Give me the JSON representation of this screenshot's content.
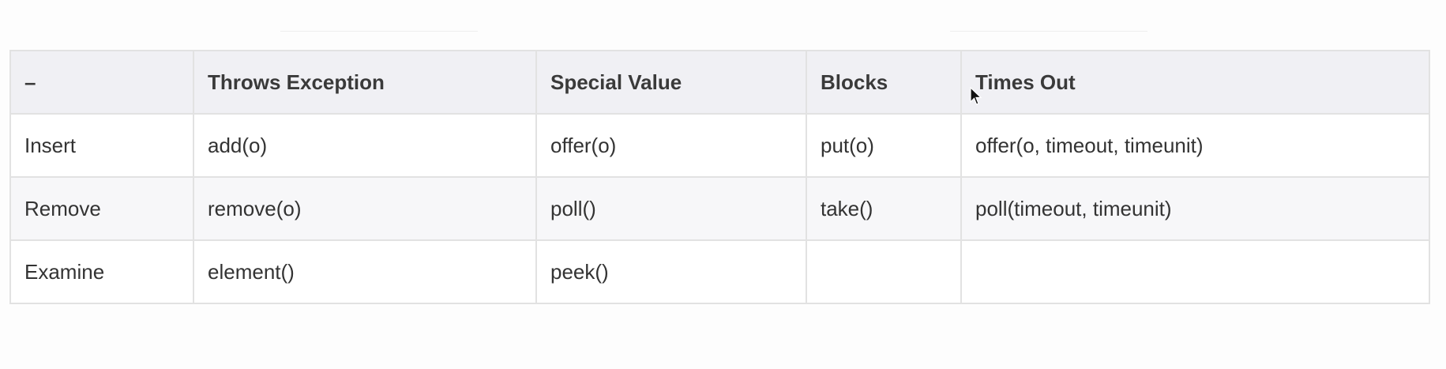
{
  "table": {
    "headers": [
      "–",
      "Throws Exception",
      "Special Value",
      "Blocks",
      "Times Out"
    ],
    "rows": [
      [
        "Insert",
        "add(o)",
        "offer(o)",
        "put(o)",
        "offer(o, timeout, timeunit)"
      ],
      [
        "Remove",
        "remove(o)",
        "poll()",
        "take()",
        "poll(timeout, timeunit)"
      ],
      [
        "Examine",
        "element()",
        "peek()",
        "",
        ""
      ]
    ]
  },
  "colors": {
    "header_background": "#f0f0f4",
    "border": "#e2e2e2",
    "text": "#333333"
  },
  "icons": {
    "cursor": "mouse-pointer-icon"
  }
}
